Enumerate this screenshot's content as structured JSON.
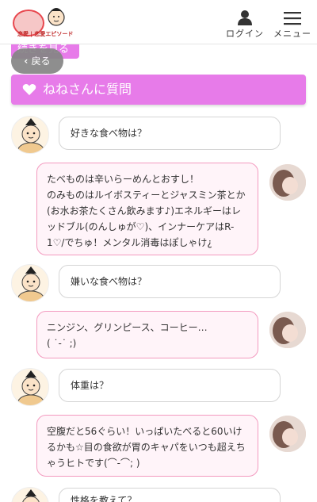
{
  "header": {
    "logo_text": "恋愛 | 恋愛エピソード",
    "login_label": "ログイン",
    "menu_label": "メニュー"
  },
  "more_tag_label": "続きを見る",
  "back_label": "戻る",
  "banner_title": "ねねさんに質問",
  "chat": [
    {
      "q": "好きな食べ物は？",
      "a": [
        "たべものは辛いらーめんとおすし！",
        "のみものはルイボスティーとジャスミン茶とか(お水お茶たくさん飲みます♪)エネルギーはレッドブル(のんしゅが♡)、インナーケアはR-1♡/でちゅ！メンタル消毒はぽしゃけ¿"
      ]
    },
    {
      "q": "嫌いな食べ物は？",
      "a": [
        "ニンジン、グリンピース、コーヒー…",
        "(  ˙-˙  ;)"
      ]
    },
    {
      "q": "体重は？",
      "a": [
        "空腹だと56ぐらい！いっぱいたべると60いけるかも☆目の食欲が胃のキャパをいつも超えちゃうヒトです(⌒-⌒; )"
      ]
    },
    {
      "q": "性格を教えて？"
    }
  ],
  "colors": {
    "accent": "#e77be9",
    "answer_border": "#f39abf",
    "answer_bg": "#fff4f9"
  }
}
